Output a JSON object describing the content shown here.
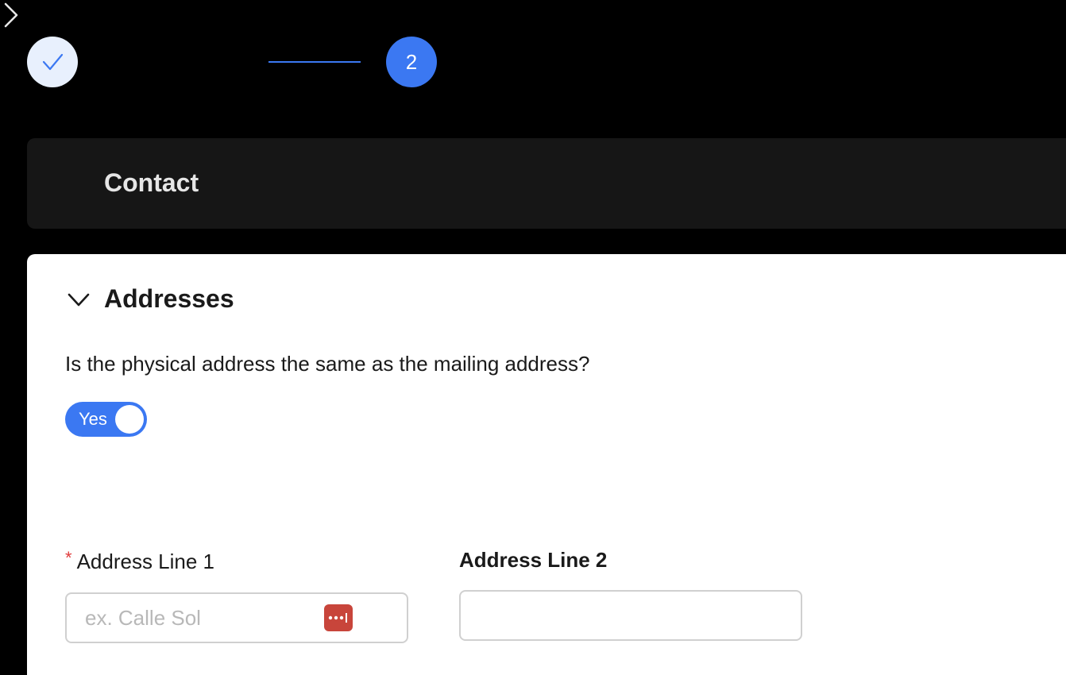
{
  "stepper": {
    "step1_icon": "check-icon",
    "step2_number": "2",
    "accent_color": "#3b78f2"
  },
  "sections": {
    "contact": {
      "title": "Contact",
      "icon": "chevron-right-icon"
    },
    "addresses": {
      "title": "Addresses",
      "icon": "chevron-down-icon",
      "question": "Is the physical address the same as the mailing address?",
      "toggle": {
        "label": "Yes",
        "on": true
      },
      "fields": {
        "address_line_1": {
          "required_mark": "*",
          "label": "Address Line 1",
          "placeholder": "ex. Calle Sol",
          "value": "",
          "autofill_icon": "password-manager-icon"
        },
        "address_line_2": {
          "label": "Address Line 2",
          "placeholder": "",
          "value": ""
        }
      }
    }
  }
}
